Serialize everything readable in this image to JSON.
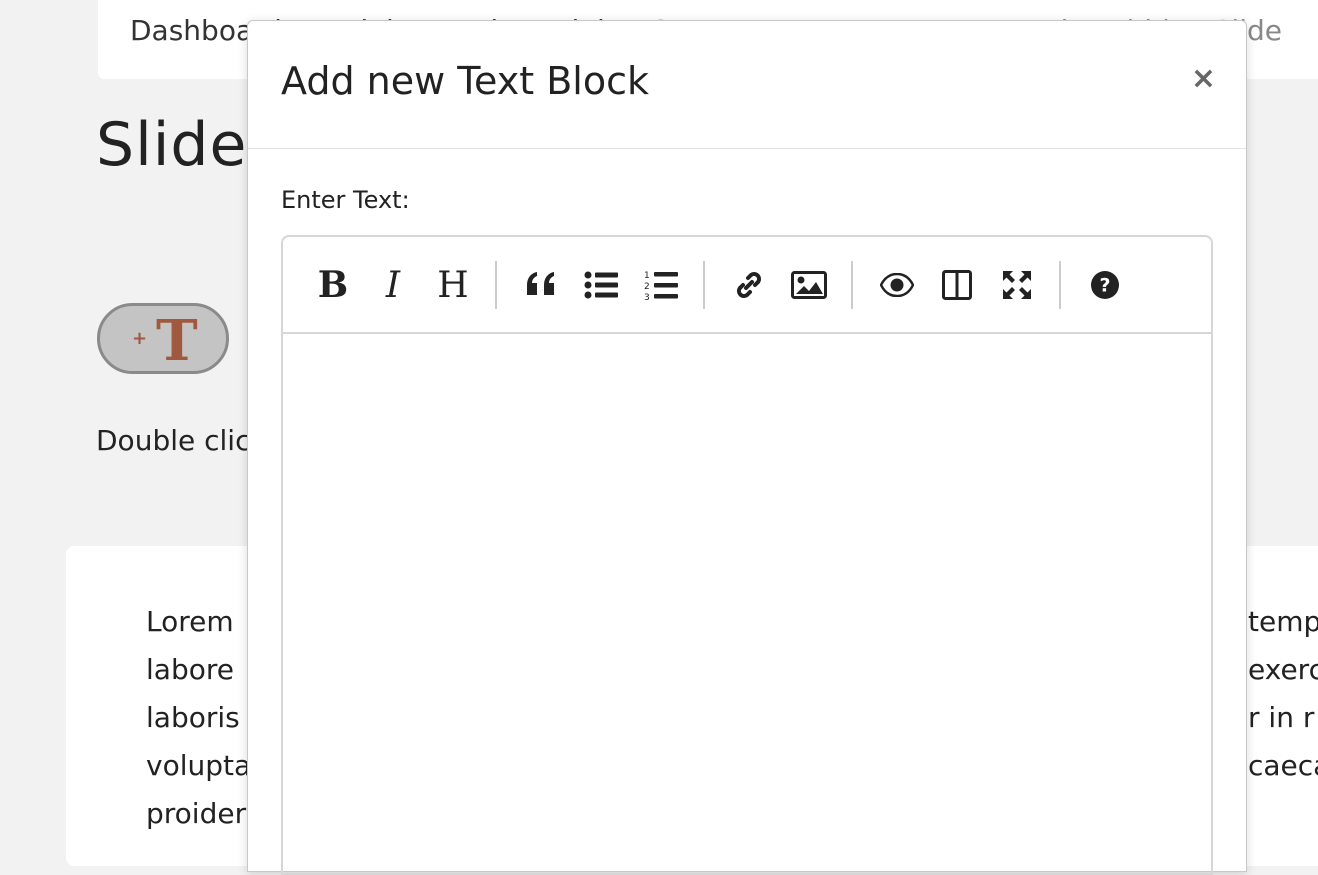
{
  "breadcrumb": {
    "text": "Dashboard / Modules / ...th module / Course ...",
    "current": "Flat Hidden Slide"
  },
  "page": {
    "heading": "Slide:",
    "hint": "Double click",
    "add_text_block": {
      "plus": "+",
      "glyph": "T"
    }
  },
  "content": {
    "lines_left": [
      "Lorem",
      "labore",
      "laboris",
      "volupta",
      "proider"
    ],
    "lines_right": [
      "temp",
      "exerc",
      "r  in  r",
      "caeca",
      ""
    ]
  },
  "modal": {
    "title": "Add new Text Block",
    "close": "×",
    "field_label": "Enter Text:",
    "toolbar": [
      {
        "name": "bold-icon",
        "label": "B"
      },
      {
        "name": "italic-icon",
        "label": "I"
      },
      {
        "name": "heading-icon",
        "label": "H"
      },
      {
        "name": "quote-icon"
      },
      {
        "name": "unordered-list-icon"
      },
      {
        "name": "ordered-list-icon"
      },
      {
        "name": "link-icon"
      },
      {
        "name": "image-icon"
      },
      {
        "name": "preview-icon"
      },
      {
        "name": "side-by-side-icon"
      },
      {
        "name": "fullscreen-icon"
      },
      {
        "name": "help-icon"
      }
    ]
  },
  "colors": {
    "accent_text_glyph": "#a0583e",
    "page_bg": "#f2f2f2"
  }
}
